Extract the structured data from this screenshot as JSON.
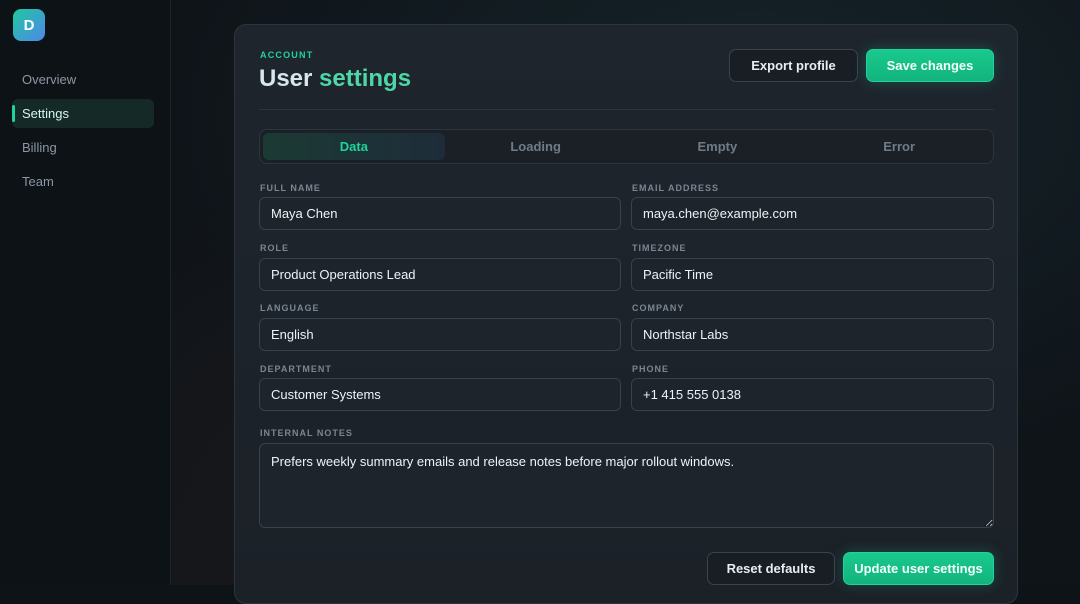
{
  "app": {
    "logo_letter": "D"
  },
  "sidebar": {
    "items": [
      {
        "label": "Overview"
      },
      {
        "label": "Settings"
      },
      {
        "label": "Billing"
      },
      {
        "label": "Team"
      }
    ],
    "active_index": 1
  },
  "header": {
    "eyebrow": "ACCOUNT",
    "title_part1": "User ",
    "title_part2": "settings",
    "export_label": "Export profile",
    "save_label": "Save changes"
  },
  "tabs": [
    {
      "label": "Data"
    },
    {
      "label": "Loading"
    },
    {
      "label": "Empty"
    },
    {
      "label": "Error"
    }
  ],
  "form": {
    "full_name": {
      "label": "FULL NAME",
      "value": "Maya Chen"
    },
    "email": {
      "label": "EMAIL ADDRESS",
      "value": "maya.chen@example.com"
    },
    "role": {
      "label": "ROLE",
      "value": "Product Operations Lead"
    },
    "timezone": {
      "label": "TIMEZONE",
      "value": "Pacific Time"
    },
    "language": {
      "label": "LANGUAGE",
      "value": "English"
    },
    "company": {
      "label": "COMPANY",
      "value": "Northstar Labs"
    },
    "department": {
      "label": "DEPARTMENT",
      "value": "Customer Systems"
    },
    "phone": {
      "label": "PHONE",
      "value": "+1 415 555 0138"
    },
    "notes": {
      "label": "INTERNAL NOTES",
      "value": "Prefers weekly summary emails and release notes before major rollout windows."
    }
  },
  "footer": {
    "reset_label": "Reset defaults",
    "update_label": "Update user settings"
  },
  "colors": {
    "accent": "#1fd39a",
    "background": "#0f1419",
    "card": "#1e252d"
  }
}
